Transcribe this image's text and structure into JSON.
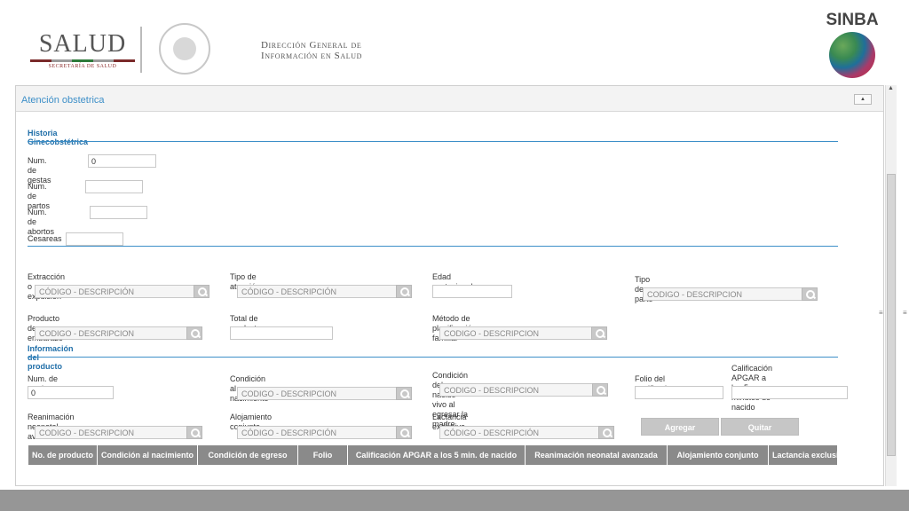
{
  "header": {
    "salud": "SALUD",
    "salud_sub": "SECRETARÍA DE SALUD",
    "dgis_line1": "Dirección General de",
    "dgis_line2": "Información en Salud",
    "sinba": "SINBA",
    "salud_bar_colors": [
      "#7a2a2a",
      "#9a9a9a",
      "#2e7a3a",
      "#9a9a9a",
      "#7a2a2a"
    ]
  },
  "panel": {
    "title": "Atención obstetrica",
    "collapse_symbol": "▲"
  },
  "historia": {
    "title": "Historia Ginecobstétrica",
    "gestas_label": "Num. de gestas",
    "gestas_value": "0",
    "partos_label": "Num. de partos",
    "partos_value": "",
    "abortos_label": "Num. de abortos",
    "abortos_value": "",
    "cesareas_label": "Cesareas",
    "cesareas_value": ""
  },
  "atencion": {
    "extraccion_label": "Extracción o expulsión",
    "extraccion_value": "CÓDIGO - DESCRIPCIÓN",
    "tipo_atencion_label": "Tipo de atención",
    "tipo_atencion_value": "CÓDIGO - DESCRIPCIÓN",
    "edad_gestacional_label": "Edad gestacional",
    "edad_gestacional_value": "",
    "tipo_parto_label": "Tipo de parto",
    "tipo_parto_value": "CODIGO - DESCRIPCION",
    "producto_embarazo_label": "Producto de un embarazo",
    "producto_embarazo_value": "CODIGO - DESCRIPCION",
    "total_productos_label": "Total de productos",
    "total_productos_value": "",
    "metodo_planificacion_label": "Método de planificación familiar",
    "metodo_planificacion_value": "CODIGO - DESCRIPCION"
  },
  "producto": {
    "title": "Información del producto",
    "num_productos_label": "Num. de productos",
    "num_productos_value": "0",
    "condicion_nacimiento_label": "Condición al nacimiento",
    "condicion_nacimiento_value": "CODIGO - DESCRIPCION",
    "condicion_egreso_label": "Condición del nacido vivo al egresar la madre",
    "condicion_egreso_value": "CODIGO - DESCRIPCION",
    "folio_label": "Folio del certificado",
    "folio_value": "",
    "apgar_label_line1": "Calificación APGAR a los 5",
    "apgar_label_line2": "minutos de nacido",
    "apgar_value": "",
    "reanimacion_label": "Reanimación neonatal avanzada",
    "reanimacion_value": "CODIGO - DESCRIPCION",
    "alojamiento_label": "Alojamiento conjunto",
    "alojamiento_value": "CÓDIGO - DESCRIPCIÓN",
    "lactancia_label": "Lactancia exclusiva",
    "lactancia_value": "CÓDIGO - DESCRIPCIÓN",
    "agregar_label": "Agregar",
    "quitar_label": "Quitar"
  },
  "grid": {
    "columns": [
      "No. de producto",
      "Condición al nacimiento",
      "Condición de egreso",
      "Folio",
      "Calificación APGAR a los 5 min. de nacido",
      "Reanimación neonatal avanzada",
      "Alojamiento conjunto",
      "Lactancia exclusiva"
    ]
  },
  "colors": {
    "accent": "#3d8fc8",
    "section_title": "#1f6ea8",
    "grid_header": "#8a8a8a",
    "button_disabled": "#c6c6c6",
    "footer": "#969696"
  }
}
